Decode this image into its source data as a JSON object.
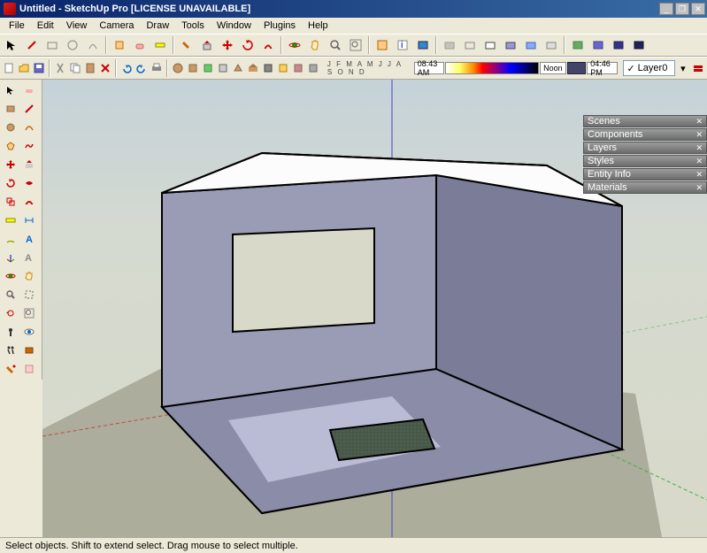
{
  "title": "Untitled - SketchUp Pro [LICENSE UNAVAILABLE]",
  "menu": {
    "file": "File",
    "edit": "Edit",
    "view": "View",
    "camera": "Camera",
    "draw": "Draw",
    "tools": "Tools",
    "window": "Window",
    "plugins": "Plugins",
    "help": "Help"
  },
  "months": "J F M A M J J A S O N D",
  "time1": "08:43 AM",
  "time2": "Noon",
  "time3": "04:46 PM",
  "layer": "Layer0",
  "panels": {
    "scenes": "Scenes",
    "components": "Components",
    "layers": "Layers",
    "styles": "Styles",
    "entity": "Entity Info",
    "materials": "Materials"
  },
  "status": "Select objects. Shift to extend select. Drag mouse to select multiple."
}
